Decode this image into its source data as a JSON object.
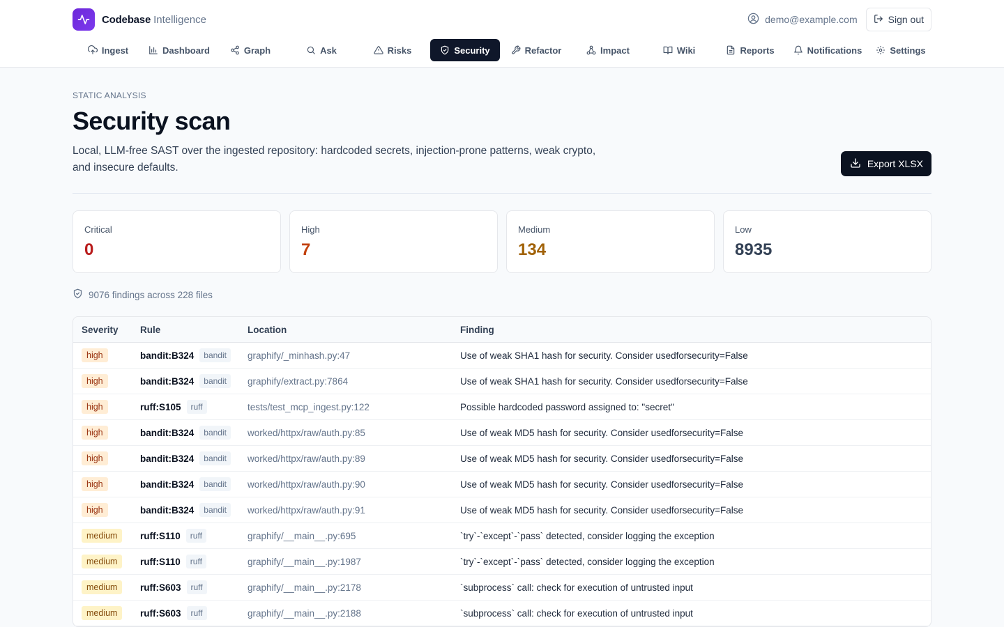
{
  "app": {
    "name": "Codebase",
    "name_suffix": "Intelligence"
  },
  "user": {
    "email": "demo@example.com",
    "signout_label": "Sign out"
  },
  "nav": [
    {
      "label": "Ingest",
      "icon": "upload-icon"
    },
    {
      "label": "Dashboard",
      "icon": "bar-chart-icon"
    },
    {
      "label": "Graph",
      "icon": "share-icon"
    },
    {
      "label": "Ask",
      "icon": "search-icon"
    },
    {
      "label": "Risks",
      "icon": "warning-icon"
    },
    {
      "label": "Security",
      "icon": "shield-icon",
      "active": true
    },
    {
      "label": "Refactor",
      "icon": "wrench-icon"
    },
    {
      "label": "Impact",
      "icon": "network-icon"
    },
    {
      "label": "Wiki",
      "icon": "book-icon"
    },
    {
      "label": "Reports",
      "icon": "document-icon"
    },
    {
      "label": "Notifications",
      "icon": "bell-icon"
    },
    {
      "label": "Settings",
      "icon": "gear-icon"
    }
  ],
  "page": {
    "eyebrow": "STATIC ANALYSIS",
    "title": "Security scan",
    "description": "Local, LLM-free SAST over the ingested repository: hardcoded secrets, injection-prone patterns, weak crypto, and insecure defaults.",
    "export_label": "Export XLSX"
  },
  "colors": {
    "critical": "#b91c1c",
    "high": "#c2410c",
    "medium": "#a16207",
    "low": "#334155",
    "accent": "#0b1220"
  },
  "stats": {
    "critical": {
      "label": "Critical",
      "value": "0"
    },
    "high": {
      "label": "High",
      "value": "7"
    },
    "medium": {
      "label": "Medium",
      "value": "134"
    },
    "low": {
      "label": "Low",
      "value": "8935"
    }
  },
  "summary": "9076 findings across 228 files",
  "table": {
    "headers": {
      "severity": "Severity",
      "rule": "Rule",
      "location": "Location",
      "finding": "Finding"
    },
    "rows": [
      {
        "severity": "high",
        "rule": "bandit:B324",
        "tool": "bandit",
        "location": "graphify/_minhash.py:47",
        "finding": "Use of weak SHA1 hash for security. Consider usedforsecurity=False"
      },
      {
        "severity": "high",
        "rule": "bandit:B324",
        "tool": "bandit",
        "location": "graphify/extract.py:7864",
        "finding": "Use of weak SHA1 hash for security. Consider usedforsecurity=False"
      },
      {
        "severity": "high",
        "rule": "ruff:S105",
        "tool": "ruff",
        "location": "tests/test_mcp_ingest.py:122",
        "finding": "Possible hardcoded password assigned to: \"secret\""
      },
      {
        "severity": "high",
        "rule": "bandit:B324",
        "tool": "bandit",
        "location": "worked/httpx/raw/auth.py:85",
        "finding": "Use of weak MD5 hash for security. Consider usedforsecurity=False"
      },
      {
        "severity": "high",
        "rule": "bandit:B324",
        "tool": "bandit",
        "location": "worked/httpx/raw/auth.py:89",
        "finding": "Use of weak MD5 hash for security. Consider usedforsecurity=False"
      },
      {
        "severity": "high",
        "rule": "bandit:B324",
        "tool": "bandit",
        "location": "worked/httpx/raw/auth.py:90",
        "finding": "Use of weak MD5 hash for security. Consider usedforsecurity=False"
      },
      {
        "severity": "high",
        "rule": "bandit:B324",
        "tool": "bandit",
        "location": "worked/httpx/raw/auth.py:91",
        "finding": "Use of weak MD5 hash for security. Consider usedforsecurity=False"
      },
      {
        "severity": "medium",
        "rule": "ruff:S110",
        "tool": "ruff",
        "location": "graphify/__main__.py:695",
        "finding": "`try`-`except`-`pass` detected, consider logging the exception"
      },
      {
        "severity": "medium",
        "rule": "ruff:S110",
        "tool": "ruff",
        "location": "graphify/__main__.py:1987",
        "finding": "`try`-`except`-`pass` detected, consider logging the exception"
      },
      {
        "severity": "medium",
        "rule": "ruff:S603",
        "tool": "ruff",
        "location": "graphify/__main__.py:2178",
        "finding": "`subprocess` call: check for execution of untrusted input"
      },
      {
        "severity": "medium",
        "rule": "ruff:S603",
        "tool": "ruff",
        "location": "graphify/__main__.py:2188",
        "finding": "`subprocess` call: check for execution of untrusted input"
      }
    ]
  }
}
